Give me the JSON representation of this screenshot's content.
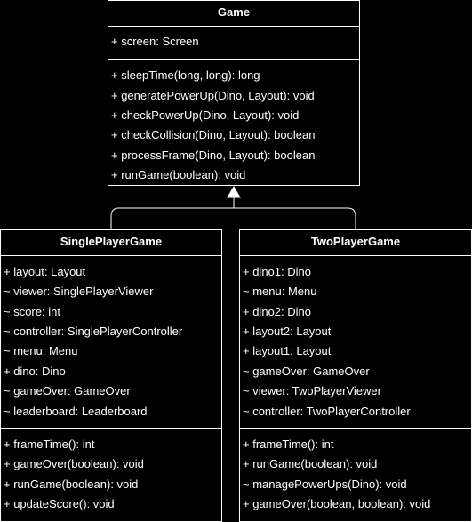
{
  "game": {
    "name": "Game",
    "attributes": [
      "+ screen: Screen"
    ],
    "methods": [
      "+ sleepTime(long, long): long",
      "+ generatePowerUp(Dino, Layout): void",
      "+ checkPowerUp(Dino, Layout): void",
      "+ checkCollision(Dino, Layout): boolean",
      "+ processFrame(Dino, Layout): boolean",
      "+ runGame(boolean): void"
    ]
  },
  "single": {
    "name": "SinglePlayerGame",
    "attributes": [
      "+ layout: Layout",
      "~ viewer: SinglePlayerViewer",
      "~ score: int",
      "~ controller: SinglePlayerController",
      "~ menu: Menu",
      "+ dino: Dino",
      "~ gameOver: GameOver",
      "~ leaderboard: Leaderboard"
    ],
    "methods": [
      "+ frameTime(): int",
      "+ gameOver(boolean): void",
      "+ runGame(boolean): void",
      "+ updateScore(): void"
    ]
  },
  "two": {
    "name": "TwoPlayerGame",
    "attributes": [
      "+ dino1: Dino",
      "~ menu: Menu",
      "+ dino2: Dino",
      "+ layout2: Layout",
      "+ layout1: Layout",
      "~ gameOver: GameOver",
      "~ viewer: TwoPlayerViewer",
      "~ controller: TwoPlayerController"
    ],
    "methods": [
      "+ frameTime(): int",
      "+ runGame(boolean): void",
      "~ managePowerUps(Dino): void",
      "+ gameOver(boolean, boolean): void"
    ]
  }
}
